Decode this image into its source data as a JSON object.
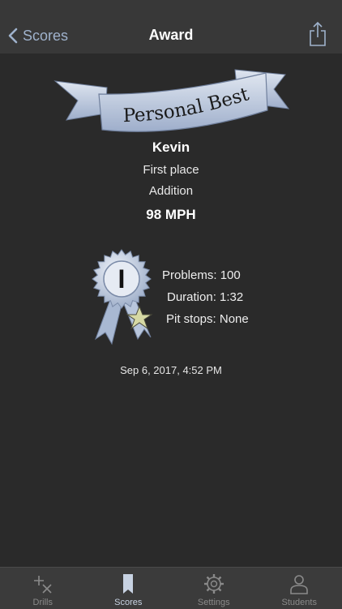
{
  "nav": {
    "back_label": "Scores",
    "title": "Award"
  },
  "award": {
    "banner_text": "Personal Best",
    "name": "Kevin",
    "place": "First place",
    "operation": "Addition",
    "speed": "98 MPH",
    "medal_numeral": "I",
    "stats": {
      "problems": "Problems: 100",
      "duration": "Duration: 1:32",
      "pit_stops": "Pit stops: None"
    },
    "date": "Sep 6, 2017, 4:52 PM"
  },
  "tabs": [
    {
      "label": "Drills",
      "icon": "drills-icon",
      "active": false
    },
    {
      "label": "Scores",
      "icon": "bookmark-icon",
      "active": true
    },
    {
      "label": "Settings",
      "icon": "gear-icon",
      "active": false
    },
    {
      "label": "Students",
      "icon": "person-icon",
      "active": false
    }
  ],
  "colors": {
    "accent": "#9fb2cc",
    "ribbon": "#b7c4d8",
    "background": "#2a2a2a"
  }
}
